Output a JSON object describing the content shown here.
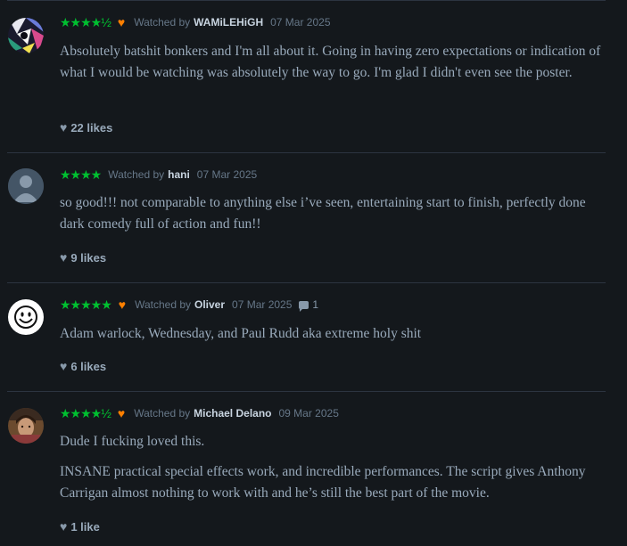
{
  "reviews": [
    {
      "rating": "★★★★½",
      "liked": true,
      "watched_by_label": "Watched by",
      "username": "WAMiLEHiGH",
      "date": "07 Mar 2025",
      "comment_count": "",
      "body": [
        "Absolutely batshit bonkers and I'm all about it. Going in having zero expectations or indication of what I would be watching was absolutely the way to go. I'm glad I didn't even see the poster."
      ],
      "likes": "22 likes",
      "avatar": "abstract-avatar"
    },
    {
      "rating": "★★★★",
      "liked": false,
      "watched_by_label": "Watched by",
      "username": "hani",
      "date": "07 Mar 2025",
      "comment_count": "",
      "body": [
        "so good!!! not comparable to anything else i’ve seen, entertaining start to finish, perfectly done dark comedy full of action and fun!!"
      ],
      "likes": "9 likes",
      "avatar": "default-avatar"
    },
    {
      "rating": "★★★★★",
      "liked": true,
      "watched_by_label": "Watched by",
      "username": "Oliver",
      "date": "07 Mar 2025",
      "comment_count": "1",
      "body": [
        "Adam warlock, Wednesday, and Paul Rudd aka extreme holy shit"
      ],
      "likes": "6 likes",
      "avatar": "smiley-avatar"
    },
    {
      "rating": "★★★★½",
      "liked": true,
      "watched_by_label": "Watched by",
      "username": "Michael Delano",
      "date": "09 Mar 2025",
      "comment_count": "",
      "body": [
        "Dude I fucking loved this.",
        "INSANE practical special effects work, and incredible performances. The script gives Anthony Carrigan almost nothing to work with and he’s still the best part of the movie."
      ],
      "likes": "1 like",
      "avatar": "photo-avatar"
    }
  ],
  "colors": {
    "background": "#14181c",
    "star": "#00c030",
    "liked_heart": "#ff8000",
    "text": "#99aabb"
  }
}
